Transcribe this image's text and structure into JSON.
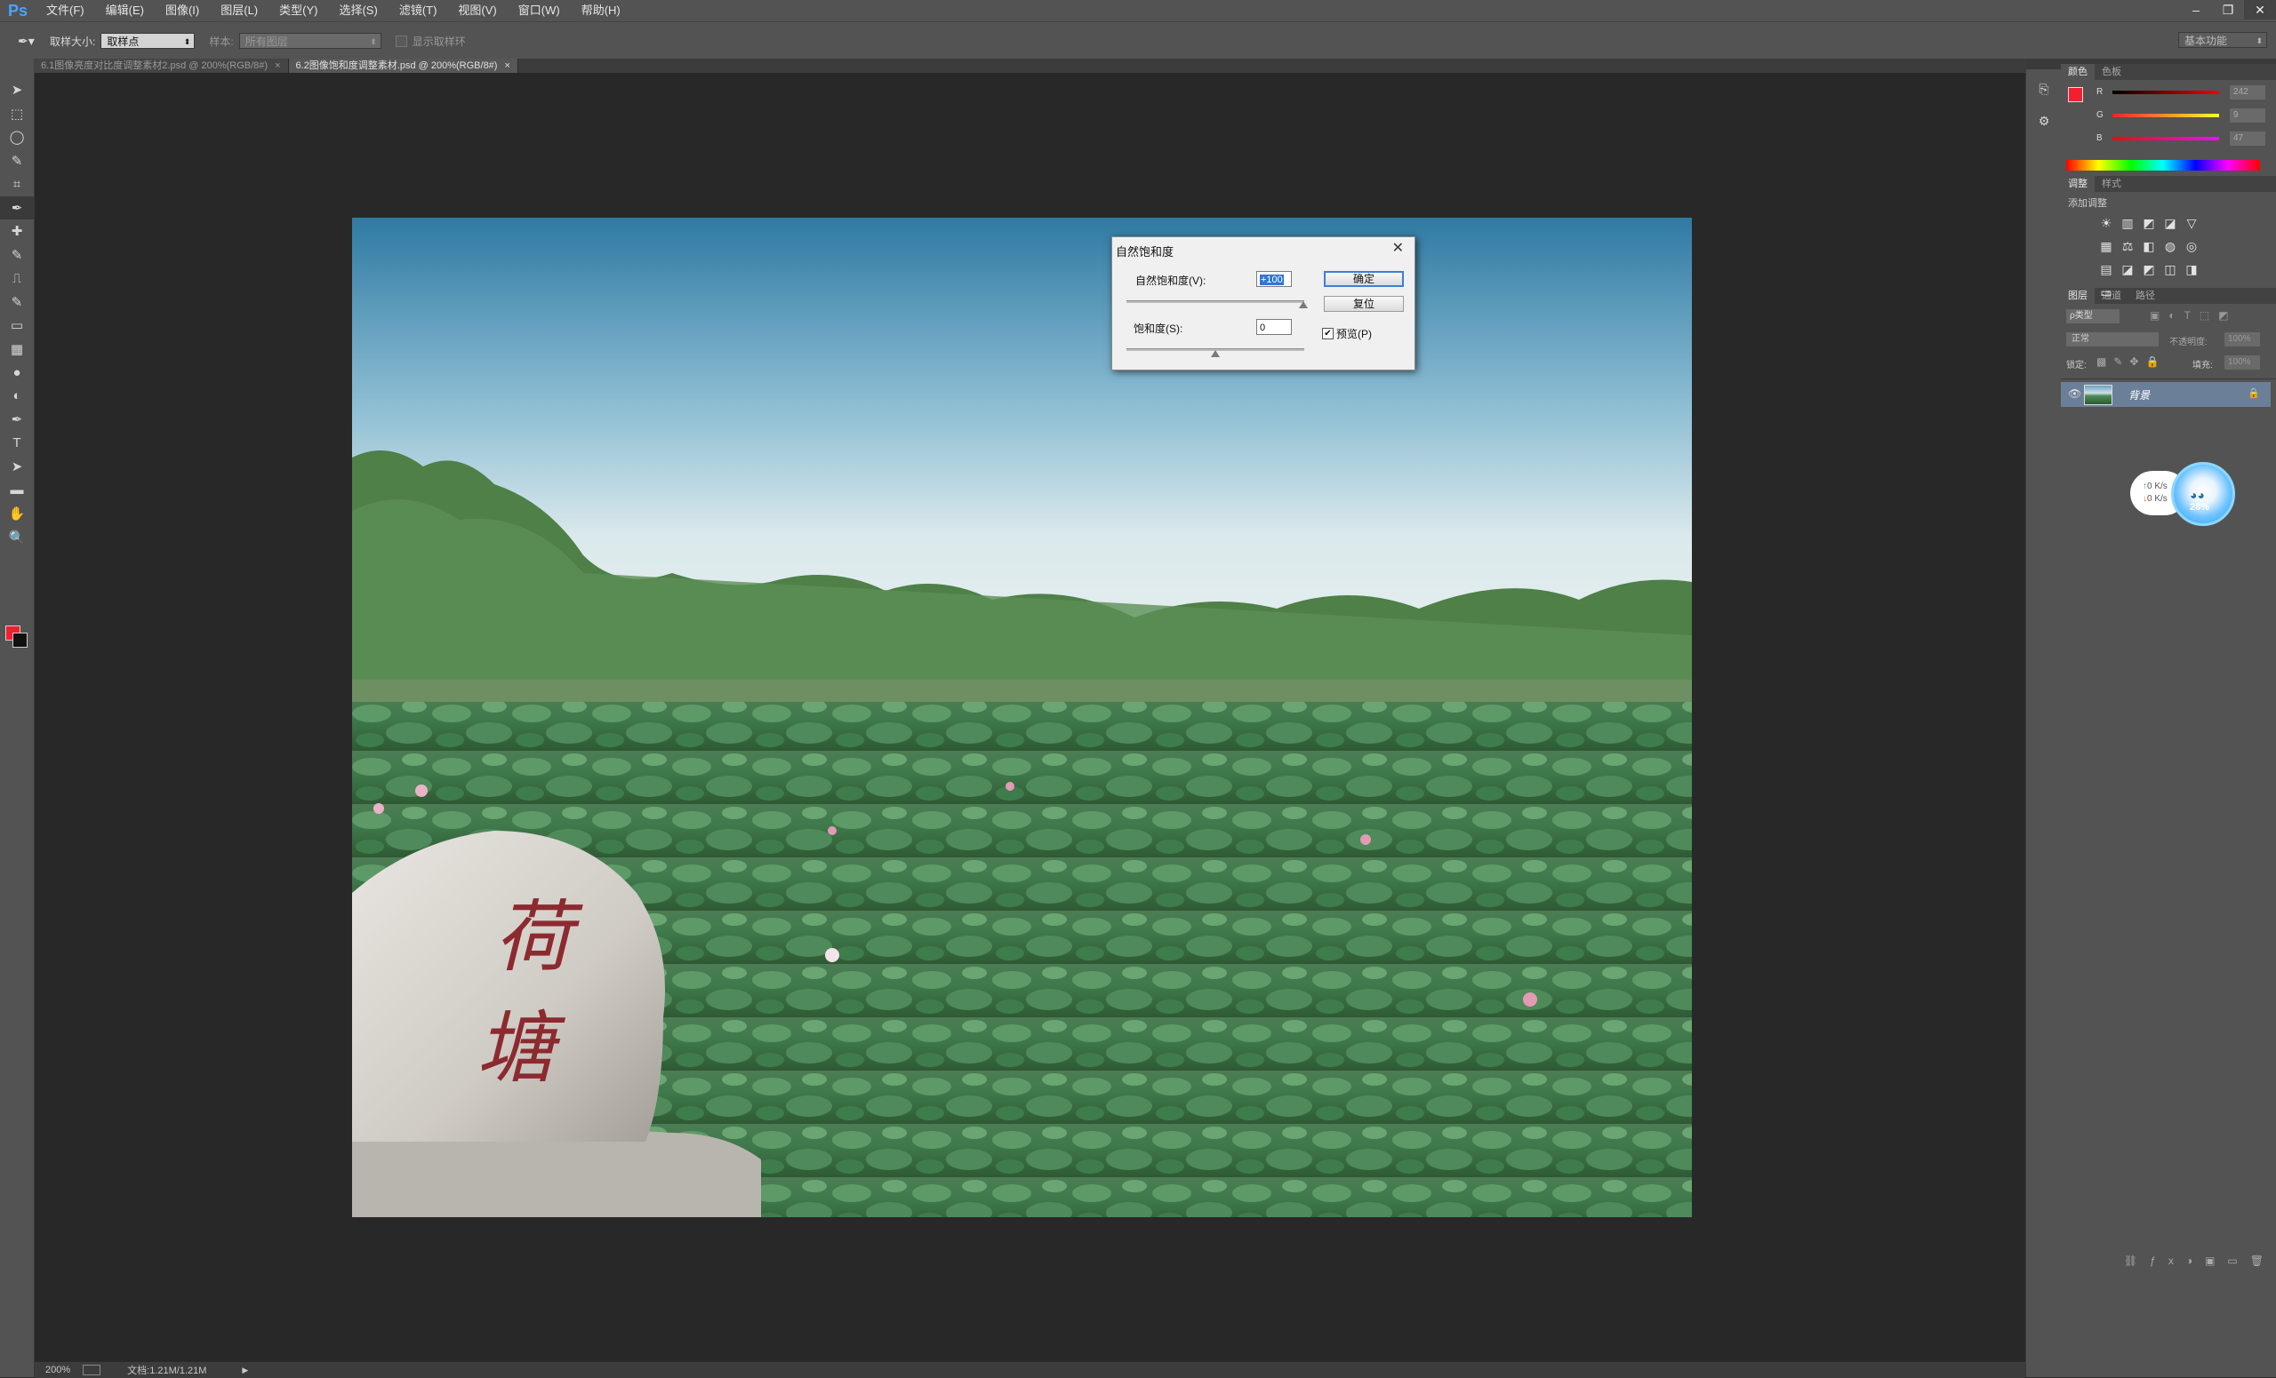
{
  "app": {
    "logo": "Ps"
  },
  "menu": [
    "文件(F)",
    "编辑(E)",
    "图像(I)",
    "图层(L)",
    "类型(Y)",
    "选择(S)",
    "滤镜(T)",
    "视图(V)",
    "窗口(W)",
    "帮助(H)"
  ],
  "options_bar": {
    "sample_size_label": "取样大小:",
    "sample_size_value": "取样点",
    "sample_label": "样本:",
    "sample_value": "所有图层",
    "show_ring_label": "显示取样环",
    "workspace": "基本功能"
  },
  "tabs": [
    {
      "label": "6.1图像亮度对比度调整素材2.psd @ 200%(RGB/8#)",
      "close": "×",
      "active": false
    },
    {
      "label": "6.2图像饱和度调整素材.psd @ 200%(RGB/8#)",
      "close": "×",
      "active": true
    }
  ],
  "tools": [
    "move-tool",
    "marquee-tool",
    "lasso-tool",
    "quick-select-tool",
    "crop-tool",
    "eyedropper-tool",
    "healing-tool",
    "brush-tool",
    "stamp-tool",
    "history-brush-tool",
    "eraser-tool",
    "gradient-tool",
    "blur-tool",
    "dodge-tool",
    "pen-tool",
    "type-tool",
    "path-select-tool",
    "shape-tool",
    "hand-tool",
    "zoom-tool"
  ],
  "tool_glyphs": [
    "➤",
    "⬚",
    "◯",
    "✎",
    "⌗",
    "✒",
    "✚",
    "✎",
    "⎍",
    "✎",
    "▭",
    "▦",
    "●",
    "◐",
    "✒",
    "T",
    "➤",
    "▬",
    "✋",
    "🔍"
  ],
  "colors": {
    "foreground": "#f21f2f",
    "background": "#111111"
  },
  "status": {
    "zoom": "200%",
    "doc_info": "文档:1.21M/1.21M"
  },
  "dialog": {
    "title": "自然饱和度",
    "vibrance_label": "自然饱和度(V):",
    "vibrance_value": "+100",
    "saturation_label": "饱和度(S):",
    "saturation_value": "0",
    "ok_label": "确定",
    "reset_label": "复位",
    "preview_label": "预览(P)",
    "preview_checked": true,
    "close": "✕"
  },
  "color_panel": {
    "tabs": [
      "颜色",
      "色板"
    ],
    "channels": [
      {
        "name": "R",
        "value": "242",
        "level": 0.95
      },
      {
        "name": "G",
        "value": "9",
        "level": 0.04
      },
      {
        "name": "B",
        "value": "47",
        "level": 0.18
      }
    ]
  },
  "adjustments_panel": {
    "tabs": [
      "调整",
      "样式"
    ],
    "add_label": "添加调整",
    "icons": [
      "brightness-icon",
      "levels-icon",
      "curves-icon",
      "exposure-icon",
      "vibrance-icon",
      "hue-saturation-icon",
      "color-balance-icon",
      "black-white-icon",
      "photo-filter-icon",
      "channel-mixer-icon",
      "color-lookup-icon",
      "invert-icon",
      "posterize-icon",
      "threshold-icon",
      "selective-color-icon",
      "gradient-map-icon"
    ],
    "glyphs": [
      "☀",
      "▥",
      "◩",
      "◪",
      "▽",
      "▦",
      "⚖",
      "◧",
      "◍",
      "◎",
      "▤",
      "◪",
      "◩",
      "◫",
      "◨",
      "▭"
    ]
  },
  "layers_panel": {
    "tabs": [
      "图层",
      "通道",
      "路径"
    ],
    "filter_label": "ρ类型",
    "blend_mode": "正常",
    "opacity_label": "不透明度:",
    "opacity_value": "100%",
    "lock_label": "锁定:",
    "fill_label": "填充:",
    "fill_value": "100%",
    "layers": [
      {
        "name": "背景",
        "visible": true,
        "locked": true
      }
    ]
  },
  "net_widget": {
    "up": "0  K/s",
    "down": "0  K/s",
    "percent": "28%"
  }
}
